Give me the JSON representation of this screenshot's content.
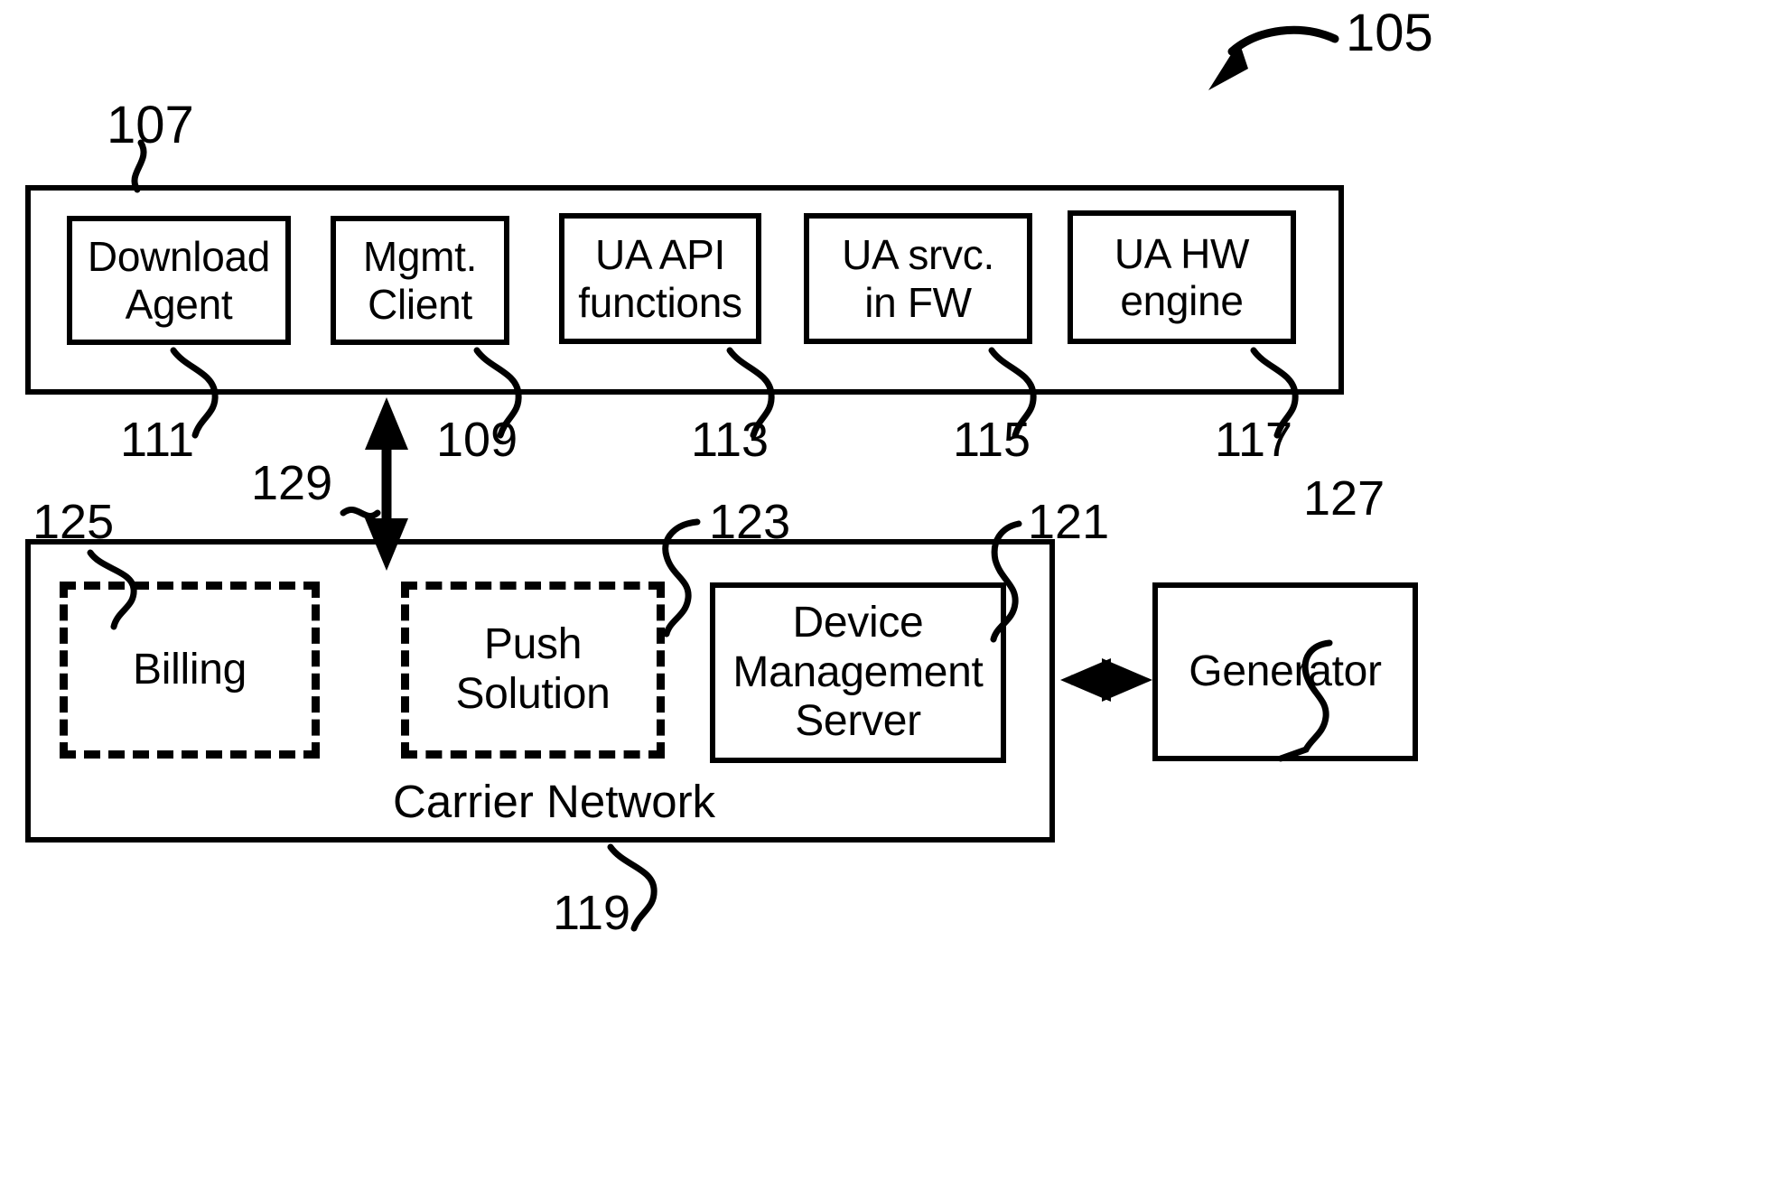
{
  "figure": {
    "overall_ref": "105",
    "device": {
      "ref": "107",
      "modules": [
        {
          "label": "Download\nAgent",
          "ref": "111"
        },
        {
          "label": "Mgmt.\nClient",
          "ref": "109"
        },
        {
          "label": "UA API\nfunctions",
          "ref": "113"
        },
        {
          "label": "UA srvc.\nin FW",
          "ref": "115"
        },
        {
          "label": "UA HW\nengine",
          "ref": "117"
        }
      ]
    },
    "carrier_network": {
      "label": "Carrier Network",
      "ref": "119",
      "blocks": [
        {
          "label": "Billing",
          "ref": "125",
          "style": "dashed"
        },
        {
          "label": "Push\nSolution",
          "ref": "123",
          "style": "dashed"
        },
        {
          "label": "Device\nManagement\nServer",
          "ref": "121",
          "style": "solid"
        }
      ]
    },
    "generator": {
      "label": "Generator",
      "ref": "127"
    },
    "links": [
      {
        "ref": "129",
        "kind": "vertical-double-arrow",
        "from": "Mgmt. Client",
        "to": "Carrier Network"
      },
      {
        "ref": "",
        "kind": "horizontal-double-arrow",
        "from": "Carrier Network",
        "to": "Generator"
      }
    ]
  }
}
